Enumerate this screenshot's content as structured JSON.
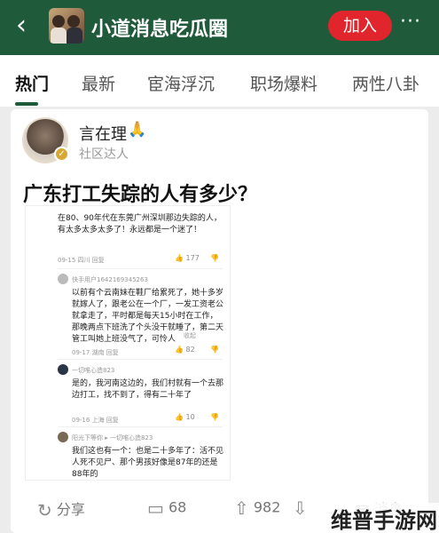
{
  "header": {
    "back_icon": "chevron-left-icon",
    "title": "小道消息吃瓜圈",
    "join_label": "加入",
    "more_label": "···",
    "accent": "#1f5a3b",
    "join_color": "#e0262c"
  },
  "tabs": [
    {
      "label": "热门",
      "active": true
    },
    {
      "label": "最新",
      "active": false
    },
    {
      "label": "宦海浮沉",
      "active": false
    },
    {
      "label": "职场爆料",
      "active": false
    },
    {
      "label": "两性八卦",
      "active": false
    }
  ],
  "post": {
    "author": "言在理",
    "author_emoji": "🙏",
    "role": "社区达人",
    "title": "广东打工失踪的人有多少？",
    "screenshot": {
      "comments": [
        {
          "text": "在80、90年代在东莞广州深圳那边失踪的人，有太多太多太多了！永远都是一个迷了！",
          "meta": "09-15 四川  回复",
          "likes": "177"
        },
        {
          "user": "快手用户1642169345263",
          "text": "以前有个云南妹在鞋厂给累死了，她十多岁就嫁人了，跟老公在一个厂，一发工资老公就拿走了，平时都是每天15小时在工作，那晚两点下班洗了个头没干就睡了，第二天管工叫她上班没气了，可怜人",
          "more": "收起",
          "meta": "09-17 湖南  回复",
          "likes": "82"
        },
        {
          "user": "一切唯心造823",
          "text": "是的，我河南这边的，我们村就有一个去那边打工，找不到了，得有二十年了",
          "meta": "09-16 上海  回复",
          "likes": "10"
        },
        {
          "user": "阳光下等你  ▸ 一切唯心造823",
          "text": "我们这也有一个：也是二十多年了：活不见人死不见尸、那个男孩好像是87年的还是88年的"
        }
      ]
    },
    "actions": {
      "share": "分享",
      "comments": "68",
      "likes": "982",
      "message": "消息"
    }
  },
  "watermark": "维普手游网"
}
